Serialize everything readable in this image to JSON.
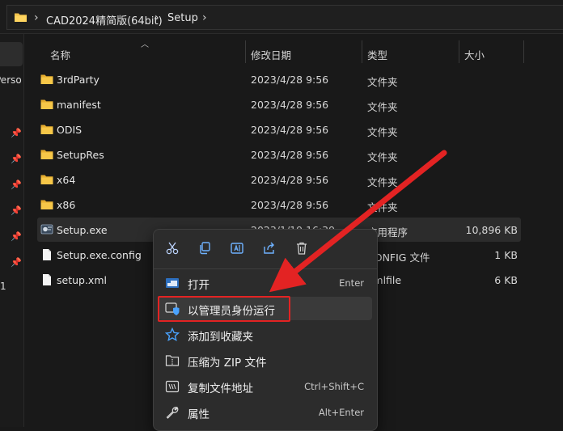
{
  "address": {
    "crumbs": [
      "CAD2024精简版(64bit)",
      "Setup"
    ],
    "separator": "›"
  },
  "nav": {
    "partial_labels": [
      "Perso",
      "1"
    ]
  },
  "columns": {
    "name": "名称",
    "date": "修改日期",
    "type": "类型",
    "size": "大小"
  },
  "files": [
    {
      "name": "3rdParty",
      "date": "2023/4/28 9:56",
      "type": "文件夹",
      "size": "",
      "icon": "folder-icon"
    },
    {
      "name": "manifest",
      "date": "2023/4/28 9:56",
      "type": "文件夹",
      "size": "",
      "icon": "folder-icon"
    },
    {
      "name": "ODIS",
      "date": "2023/4/28 9:56",
      "type": "文件夹",
      "size": "",
      "icon": "folder-icon"
    },
    {
      "name": "SetupRes",
      "date": "2023/4/28 9:56",
      "type": "文件夹",
      "size": "",
      "icon": "folder-icon"
    },
    {
      "name": "x64",
      "date": "2023/4/28 9:56",
      "type": "文件夹",
      "size": "",
      "icon": "folder-icon"
    },
    {
      "name": "x86",
      "date": "2023/4/28 9:56",
      "type": "文件夹",
      "size": "",
      "icon": "folder-icon"
    },
    {
      "name": "Setup.exe",
      "date": "2023/1/19 16:39",
      "type": "应用程序",
      "size": "10,896 KB",
      "icon": "exe-icon"
    },
    {
      "name": "Setup.exe.config",
      "date": "",
      "type": "CONFIG 文件",
      "size": "1 KB",
      "icon": "file-icon"
    },
    {
      "name": "setup.xml",
      "date": "",
      "type": "xmlfile",
      "size": "6 KB",
      "icon": "file-icon"
    }
  ],
  "context_menu": {
    "toolbar": [
      "cut-icon",
      "copy-icon",
      "rename-icon",
      "share-icon",
      "delete-icon"
    ],
    "items": [
      {
        "label": "打开",
        "shortcut": "Enter",
        "icon": "open-icon"
      },
      {
        "label": "以管理员身份运行",
        "shortcut": "",
        "icon": "shield-icon"
      },
      {
        "label": "添加到收藏夹",
        "shortcut": "",
        "icon": "star-icon"
      },
      {
        "label": "压缩为 ZIP 文件",
        "shortcut": "",
        "icon": "zip-icon"
      },
      {
        "label": "复制文件地址",
        "shortcut": "Ctrl+Shift+C",
        "icon": "copy-path-icon"
      },
      {
        "label": "属性",
        "shortcut": "Alt+Enter",
        "icon": "properties-icon"
      }
    ]
  },
  "colors": {
    "accent_blue": "#4aa3ff",
    "folder_yellow": "#f0c24b",
    "annotation_red": "#e32323"
  }
}
